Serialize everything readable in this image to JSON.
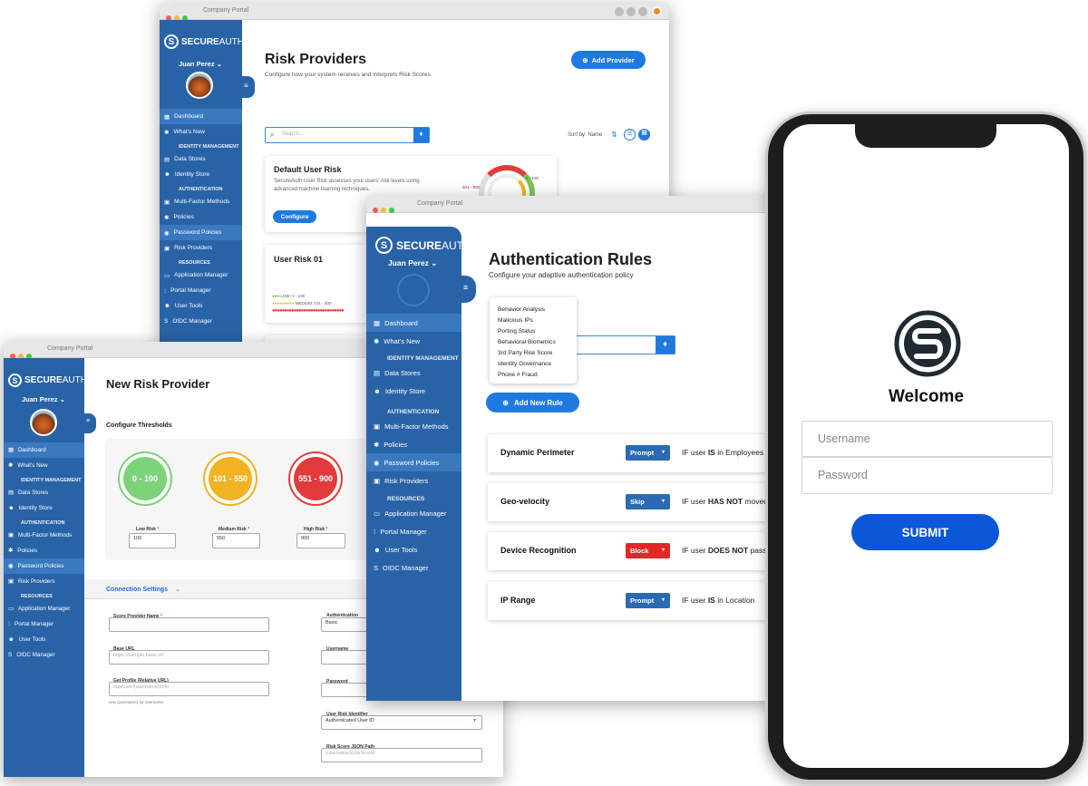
{
  "brand": {
    "logo_text_bold": "SECURE",
    "logo_text_light": "AUTH",
    "window_title": "Company Portal",
    "user_name": "Juan Perez",
    "accent": "#1f7ae0",
    "sidebar_color": "#2963a7"
  },
  "risk_providers": {
    "title": "Risk Providers",
    "subtitle": "Configure how your system receives and interprets Risk Scores.",
    "add_button": "Add Provider",
    "search_placeholder": "Search...",
    "sort_label": "Sort by: Name",
    "card1": {
      "title": "Default User Risk",
      "desc": "SecureAuth User Risk assesses your users' risk levels using advanced machine learning techniques.",
      "button": "Configure",
      "gauge_high": "501 - 900",
      "gauge_low": "0 - 100"
    },
    "card2": {
      "title": "User Risk 01",
      "legend_low": "LOW: 0 - 100",
      "legend_medium": "MEDIUM: 101 - 500"
    }
  },
  "sidebar_main": {
    "items_a": [
      {
        "label": "Dashboard",
        "icon": "grid-icon"
      },
      {
        "label": "What's New",
        "icon": "star-icon"
      }
    ],
    "section_identity": "IDENTITY MANAGEMENT",
    "items_b": [
      {
        "label": "Data Stores",
        "icon": "database-icon"
      },
      {
        "label": "Identity Store",
        "icon": "users-icon"
      }
    ],
    "section_auth": "AUTHENTICATION",
    "items_c": [
      {
        "label": "Multi-Factor Methods",
        "icon": "lock-icon"
      },
      {
        "label": "Policies",
        "icon": "settings-icon"
      },
      {
        "label": "Password Policies",
        "icon": "user-icon"
      },
      {
        "label": "Risk Providers",
        "icon": "lock-icon"
      }
    ],
    "section_resources": "RESOURCES",
    "items_d": [
      {
        "label": "Application Manager",
        "icon": "monitor-icon"
      },
      {
        "label": "Portal Manager",
        "icon": "apps-icon"
      },
      {
        "label": "User Tools",
        "icon": "users-icon"
      },
      {
        "label": "OIDC Manager",
        "icon": "oidc-icon"
      }
    ]
  },
  "new_risk": {
    "title": "New Risk Provider",
    "thresholds_label": "Configure Thresholds",
    "low": {
      "range": "0 - 100",
      "label": "Low Risk",
      "value": "100"
    },
    "medium": {
      "range": "101 - 550",
      "label": "Medium Risk",
      "value": "550"
    },
    "high": {
      "range": "551 - 900",
      "label": "High Risk",
      "value": "900"
    },
    "connection_label": "Connection Settings",
    "score_provider_label": "Score Provider Name",
    "base_url_label": "Base URL",
    "base_url_placeholder": "https://sample.base.url",
    "get_profile_label": "Get Profile (Relative URL)",
    "get_profile_placeholder": "/api/user/{username}/info",
    "get_profile_hint": "Use {username} for username",
    "auth_label": "Authentication",
    "auth_value": "Basic",
    "username_label": "Username",
    "password_label": "Password",
    "uri_label": "User Risk Identifier",
    "uri_value": "Authenticated User ID",
    "json_path_label": "Risk Score JSON Path",
    "json_path_placeholder": "{username}{riskScore}"
  },
  "auth_rules": {
    "title": "Authentication Rules",
    "subtitle": "Configure your adaptive authentication policy",
    "dropdown_items": [
      "Behavior Analysis",
      "Malicious IPs",
      "Porting Status",
      "Behavioral Biometrics",
      "3rd Party Risk Score",
      "Identity Governance",
      "Phone # Fraud"
    ],
    "add_rule": "Add New Rule",
    "rules": [
      {
        "name": "Dynamic Perimeter",
        "action": "Prompt",
        "color": "#2a6ab3",
        "cond_pre": "IF user ",
        "cond_bold": "IS",
        "cond_post": " in Employees"
      },
      {
        "name": "Geo-velocity",
        "action": "Skip",
        "color": "#2a6ab3",
        "cond_pre": "IF user ",
        "cond_bold": "HAS NOT",
        "cond_post": " moved"
      },
      {
        "name": "Device Recognition",
        "action": "Block",
        "color": "#e32626",
        "cond_pre": "IF user ",
        "cond_bold": "DOES NOT",
        "cond_post": " pass"
      },
      {
        "name": "IP Range",
        "action": "Prompt",
        "color": "#2a6ab3",
        "cond_pre": "IF user ",
        "cond_bold": "IS",
        "cond_post": " in Location"
      }
    ]
  },
  "mobile": {
    "welcome": "Welcome",
    "username_placeholder": "Username",
    "password_placeholder": "Password",
    "submit": "SUBMIT"
  }
}
